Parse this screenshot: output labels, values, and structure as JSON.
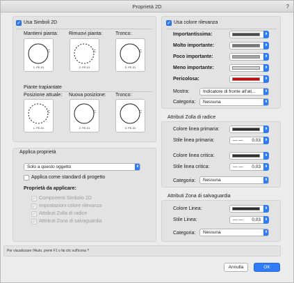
{
  "window": {
    "title": "Proprietà 2D",
    "help_mark": "?"
  },
  "left": {
    "use_2d_label": "Usa Simboli 2D",
    "top_headers": {
      "mantieni": "Mantieni pianta:",
      "rimuovi": "Rimuovi pianta:",
      "tronco": "Tronco:"
    },
    "trapiantate_title": "Piante trapiantate",
    "bottom_headers": {
      "attuale": "Posizione attuale:",
      "nuova": "Nuova posizione:",
      "tronco": "Tronco:"
    },
    "symbols": {
      "top": [
        "1. PE-01",
        "2. PE-01",
        "3. PE-01"
      ],
      "bottom": [
        "1. PE-01",
        "2. PE-01",
        "3. PE-01"
      ],
      "dim_mark": "C"
    }
  },
  "applica": {
    "title": "Applica proprietà",
    "target_value": "Solo a questo oggetto",
    "standard_label": "Applica come standard di progetto",
    "props_title": "Proprietà da applicare:",
    "props": [
      "Componenti Simbolo 2D",
      "Impostazioni colore rilevanza",
      "Attributi Zolla di radice",
      "Attributi Zona di salvaguardia"
    ]
  },
  "rilevanza": {
    "use_label": "Usa colore rilevanza",
    "rows": [
      {
        "label": "Importantissima:",
        "color": "#4a4a4a"
      },
      {
        "label": "Molto importante:",
        "color": "#777777"
      },
      {
        "label": "Poco importante:",
        "color": "#a5a5a5"
      },
      {
        "label": "Meno importante:",
        "color": "#d0d0d0"
      },
      {
        "label": "Pericolosa:",
        "color": "#dd0000"
      }
    ],
    "mostra_label": "Mostra:",
    "mostra_value": "Indicatore di fronte all'ati...",
    "categoria_label": "Categoria:",
    "categoria_value": "Nessuna"
  },
  "zolla": {
    "title": "Attributi Zolla di radice",
    "colore_primaria_label": "Colore linea primaria:",
    "stile_primaria_label": "Stile linea primaria:",
    "colore_critica_label": "Colore linea critica:",
    "stile_critica_label": "Stile linea critica:",
    "line_color": "#2e2e2e",
    "stile_dash": "— —",
    "stile_value_1": "0,03",
    "stile_value_2": "0,03",
    "categoria_label": "Categoria:",
    "categoria_value": "Nessuna"
  },
  "salvaguardia": {
    "title": "Attributi Zona di salvaguardia",
    "colore_label": "Colore Linea:",
    "stile_label": "Stile Linea:",
    "line_color": "#2e2e2e",
    "stile_dash": "— —",
    "stile_value": "0,03",
    "categoria_label": "Categoria:",
    "categoria_value": "Nessuna"
  },
  "footer": {
    "help_text": "Per visualizzare l'Aiuto, premi F1 o fai clic sull'icona ?",
    "cancel_label": "Annulla",
    "ok_label": "OK"
  },
  "icons": {
    "check": "✓",
    "popup_arrows": "⬍"
  }
}
